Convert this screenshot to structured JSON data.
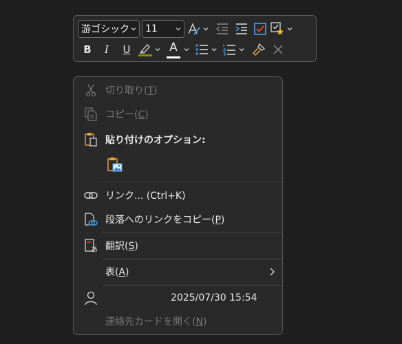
{
  "toolbar": {
    "font_name": "游ゴシック",
    "font_size": "11",
    "bold_label": "B",
    "italic_label": "I",
    "underline_label": "U",
    "font_color_label": "A",
    "highlight_color": "#8a8a00",
    "font_color": "#ffffff"
  },
  "menu": {
    "cut": {
      "label": "切り取り(",
      "key": "T",
      "end": ")"
    },
    "copy": {
      "label": "コピー(",
      "key": "C",
      "end": ")"
    },
    "paste_options": {
      "label": "貼り付けのオプション:"
    },
    "link": {
      "label": "リンク...  (Ctrl+K)"
    },
    "copy_link": {
      "label": "段落へのリンクをコピー(",
      "key": "P",
      "end": ")"
    },
    "translate": {
      "label": "翻訳(",
      "key": "S",
      "end": ")"
    },
    "table": {
      "label": "表(",
      "key": "A",
      "end": ")"
    },
    "timestamp": "2025/07/30 15:54",
    "contact_card": {
      "label": "連絡先カードを開く(",
      "key": "N",
      "end": ")"
    }
  },
  "colors": {
    "accent_blue": "#4aa0e6",
    "clipboard_orange": "#e8a33a"
  }
}
